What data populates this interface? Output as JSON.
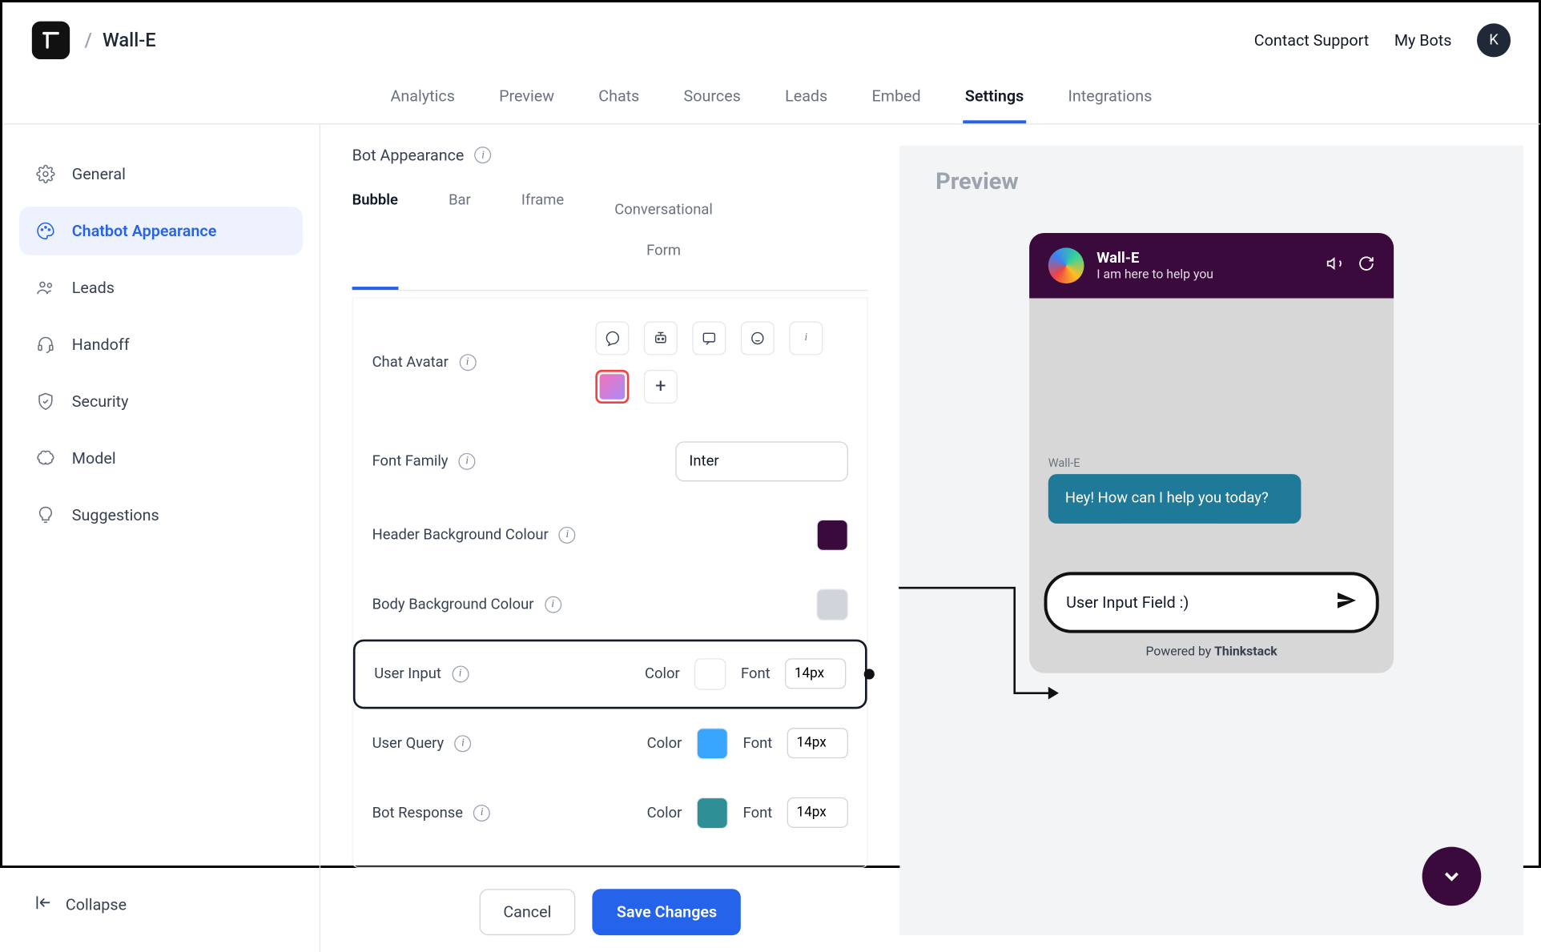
{
  "header": {
    "breadcrumb_sep": "/",
    "bot_name": "Wall-E",
    "contact_support": "Contact Support",
    "my_bots": "My Bots",
    "user_initial": "K"
  },
  "nav": {
    "items": [
      "Analytics",
      "Preview",
      "Chats",
      "Sources",
      "Leads",
      "Embed",
      "Settings",
      "Integrations"
    ],
    "active": "Settings"
  },
  "sidebar": {
    "items": [
      {
        "label": "General",
        "icon": "gear-icon"
      },
      {
        "label": "Chatbot Appearance",
        "icon": "palette-icon",
        "active": true
      },
      {
        "label": "Leads",
        "icon": "users-icon"
      },
      {
        "label": "Handoff",
        "icon": "headset-icon"
      },
      {
        "label": "Security",
        "icon": "shield-icon"
      },
      {
        "label": "Model",
        "icon": "brain-icon"
      },
      {
        "label": "Suggestions",
        "icon": "lightbulb-icon"
      }
    ],
    "collapse": "Collapse"
  },
  "form": {
    "section_title": "Bot Appearance",
    "subtabs": {
      "bubble": "Bubble",
      "bar": "Bar",
      "iframe": "Iframe",
      "cf1": "Conversational",
      "cf2": "Form"
    },
    "chat_avatar_label": "Chat Avatar",
    "font_family_label": "Font Family",
    "font_family_value": "Inter",
    "header_bg_label": "Header Background Colour",
    "body_bg_label": "Body Background Colour",
    "user_input_label": "User Input",
    "user_query_label": "User Query",
    "bot_response_label": "Bot Response",
    "color_label": "Color",
    "font_label": "Font",
    "user_input_font": "14px",
    "user_query_font": "14px",
    "bot_response_font": "14px",
    "colors": {
      "header_bg": "#3b0a3d",
      "body_bg": "#d1d5db",
      "user_input_color": "#ffffff",
      "user_query_color": "#38a5ff",
      "bot_response_color": "#2e8f96"
    }
  },
  "actions": {
    "cancel": "Cancel",
    "save": "Save Changes"
  },
  "preview": {
    "title": "Preview",
    "bot_title": "Wall-E",
    "bot_sub": "I am here to help you",
    "bot_name_label": "Wall-E",
    "bot_greeting": "Hey! How can I help you today?",
    "input_value": "User Input Field :)",
    "powered_prefix": "Powered by ",
    "powered_brand": "Thinkstack"
  }
}
